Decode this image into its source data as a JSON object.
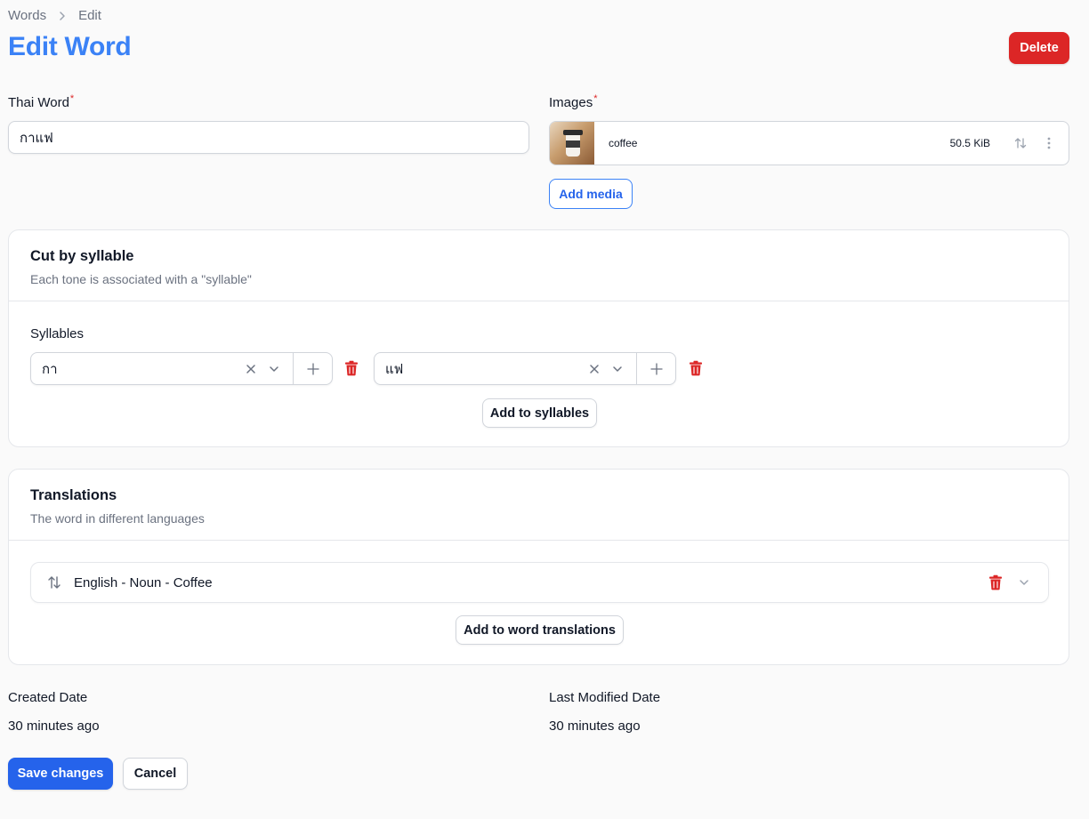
{
  "breadcrumb": {
    "root": "Words",
    "current": "Edit"
  },
  "header": {
    "title": "Edit Word",
    "delete_label": "Delete"
  },
  "thai_word": {
    "label": "Thai Word",
    "required_mark": "*",
    "value": "กาแฟ"
  },
  "images": {
    "label": "Images",
    "required_mark": "*",
    "items": [
      {
        "name": "coffee",
        "size": "50.5 KiB"
      }
    ],
    "add_media_label": "Add media"
  },
  "syllables_section": {
    "title": "Cut by syllable",
    "description": "Each tone is associated with a \"syllable\"",
    "field_label": "Syllables",
    "items": [
      {
        "value": "กา"
      },
      {
        "value": "แฟ"
      }
    ],
    "add_label": "Add to syllables"
  },
  "translations_section": {
    "title": "Translations",
    "description": "The word in different languages",
    "items": [
      {
        "label": "English - Noun - Coffee"
      }
    ],
    "add_label": "Add to word translations"
  },
  "meta": {
    "created_label": "Created Date",
    "created_value": "30 minutes ago",
    "modified_label": "Last Modified Date",
    "modified_value": "30 minutes ago"
  },
  "actions": {
    "save_label": "Save changes",
    "cancel_label": "Cancel"
  },
  "colors": {
    "primary": "#2563eb",
    "title": "#3b82f6",
    "danger": "#dc2626"
  }
}
